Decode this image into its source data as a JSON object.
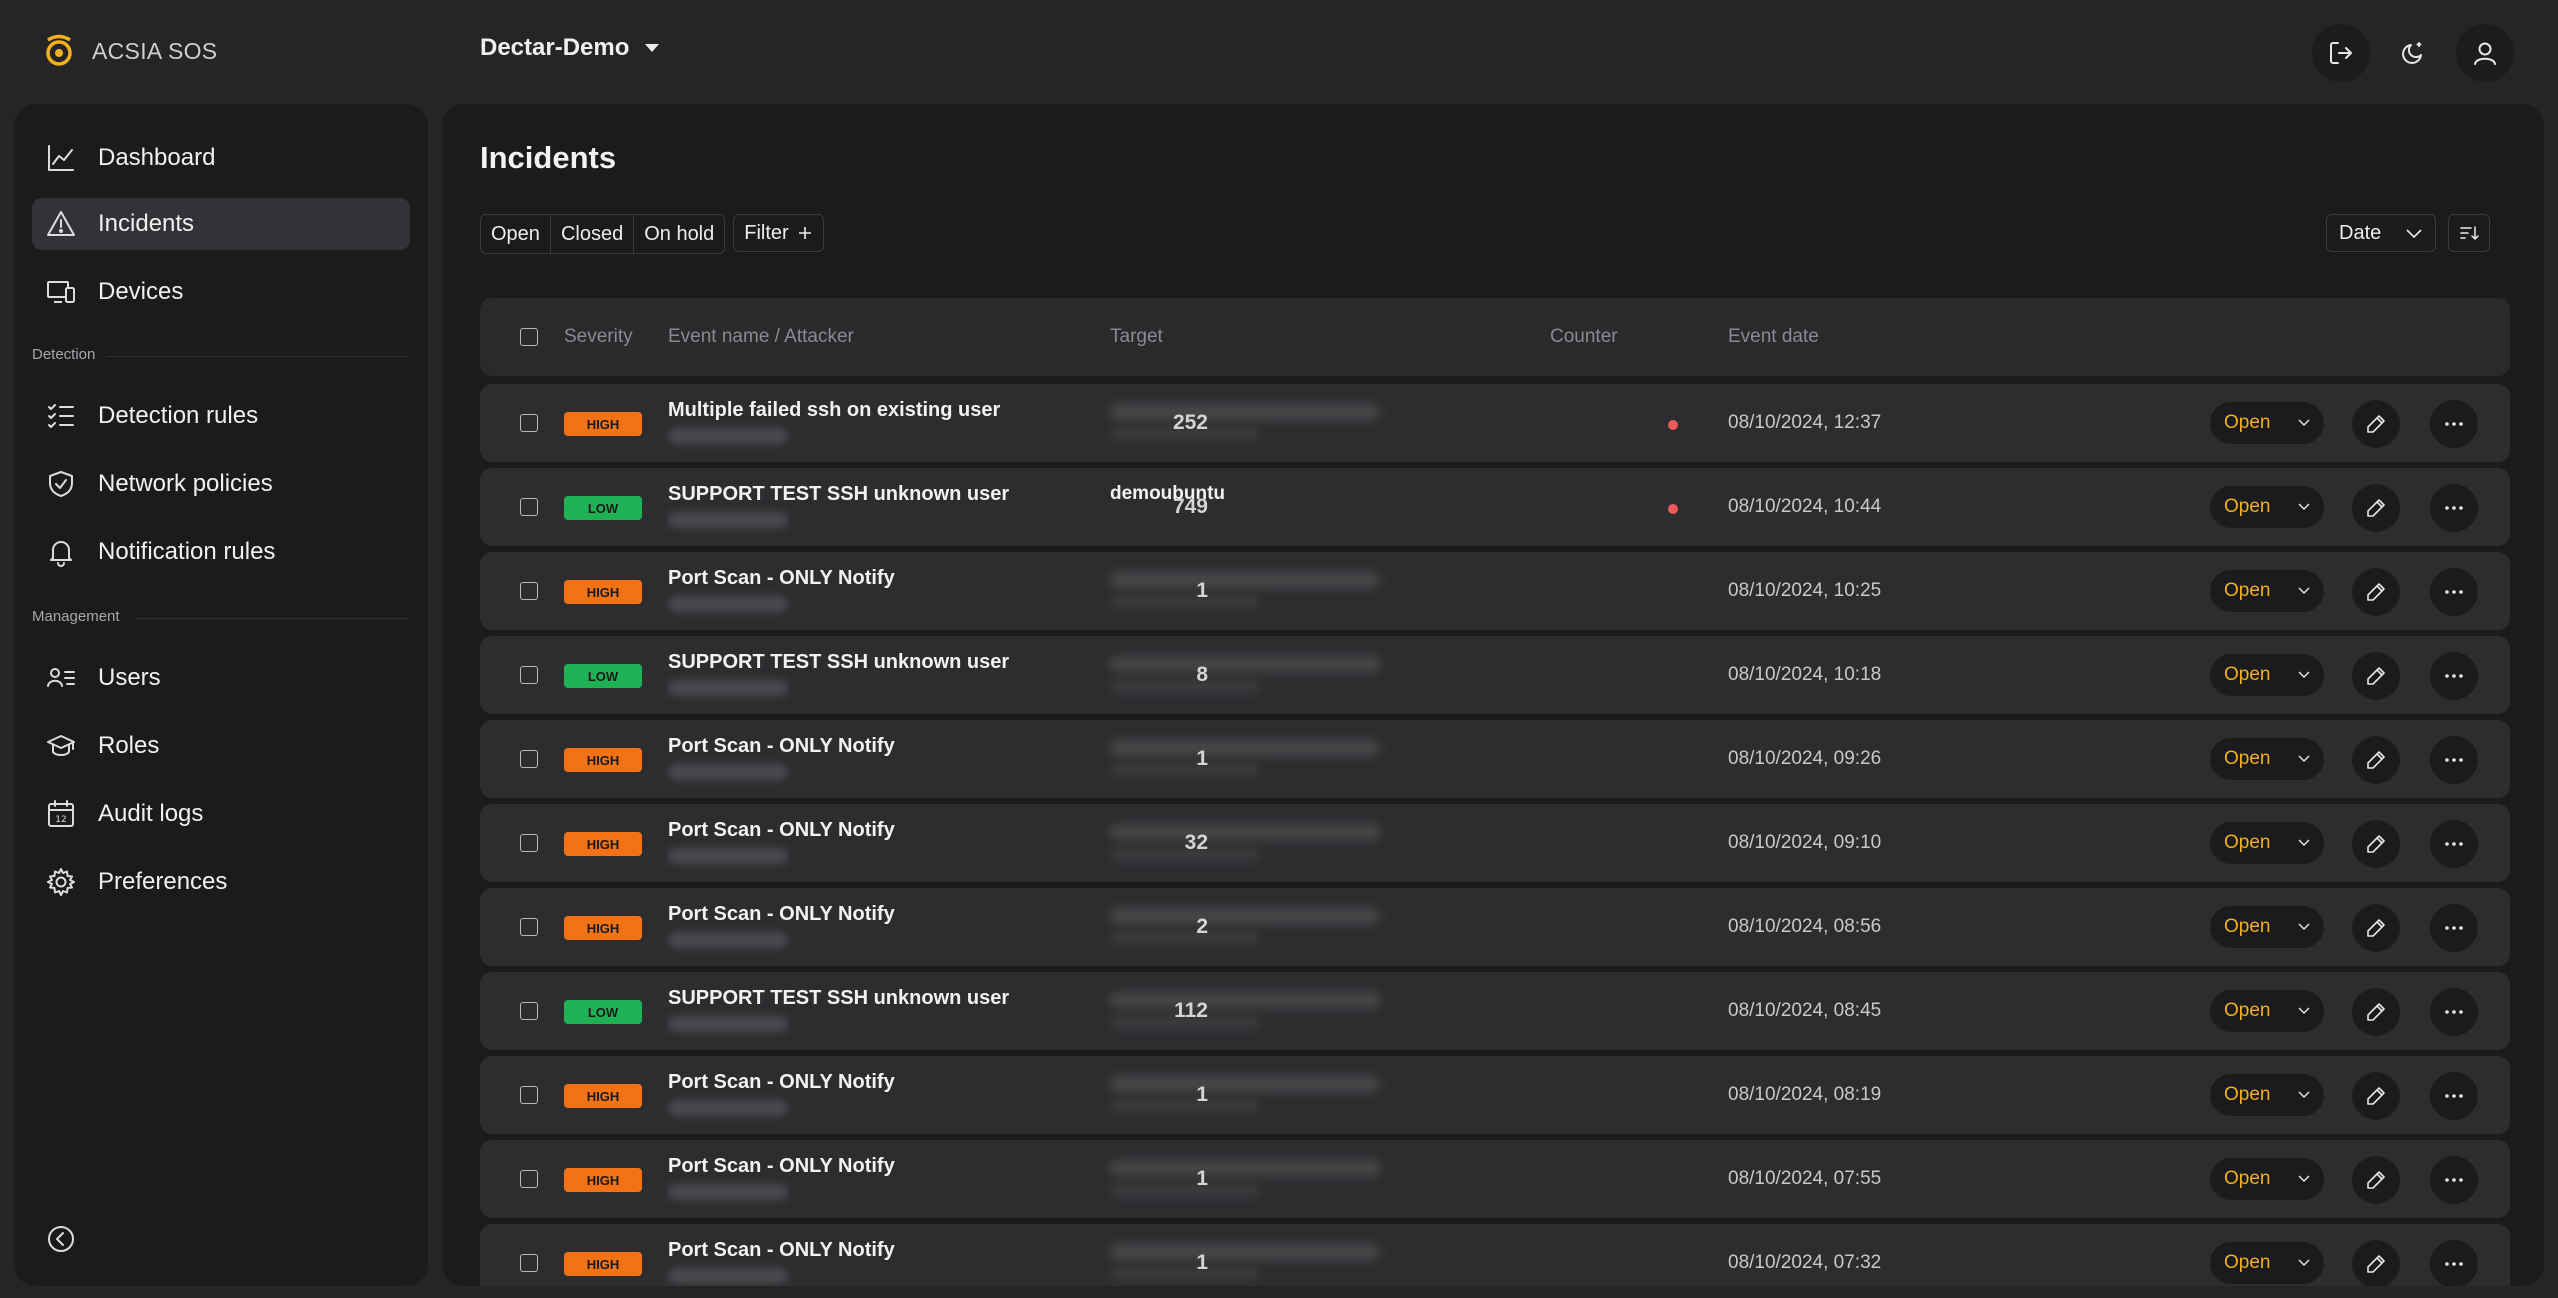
{
  "app": {
    "name": "ACSIA SOS",
    "org": "Dectar-Demo"
  },
  "sidebar": {
    "items": [
      {
        "label": "Dashboard",
        "icon": "chart-line-icon"
      },
      {
        "label": "Incidents",
        "icon": "warning-triangle-icon",
        "active": true
      },
      {
        "label": "Devices",
        "icon": "devices-icon"
      },
      {
        "label": "Detection rules",
        "icon": "checklist-icon"
      },
      {
        "label": "Network policies",
        "icon": "shield-check-icon"
      },
      {
        "label": "Notification rules",
        "icon": "bell-icon"
      },
      {
        "label": "Users",
        "icon": "users-list-icon"
      },
      {
        "label": "Roles",
        "icon": "graduation-cap-icon"
      },
      {
        "label": "Audit logs",
        "icon": "calendar-icon"
      },
      {
        "label": "Preferences",
        "icon": "gear-icon"
      }
    ],
    "sections": {
      "detection": "Detection",
      "management": "Management"
    }
  },
  "page": {
    "title": "Incidents"
  },
  "filters": {
    "open": "Open",
    "closed": "Closed",
    "on_hold": "On hold",
    "filter": "Filter"
  },
  "sort": {
    "field": "Date"
  },
  "table": {
    "headers": {
      "severity": "Severity",
      "event": "Event name / Attacker",
      "target": "Target",
      "counter": "Counter",
      "date": "Event date"
    },
    "rows": [
      {
        "severity": "HIGH",
        "event": "Multiple failed ssh on existing user",
        "target": "",
        "counter": "252",
        "alert": true,
        "date": "08/10/2024, 12:37",
        "status": "Open"
      },
      {
        "severity": "LOW",
        "event": "SUPPORT TEST SSH unknown user",
        "target": "demoubuntu",
        "counter": "749",
        "alert": true,
        "date": "08/10/2024, 10:44",
        "status": "Open"
      },
      {
        "severity": "HIGH",
        "event": "Port Scan - ONLY Notify",
        "target": "",
        "counter": "1",
        "alert": false,
        "date": "08/10/2024, 10:25",
        "status": "Open"
      },
      {
        "severity": "LOW",
        "event": "SUPPORT TEST SSH unknown user",
        "target": "",
        "counter": "8",
        "alert": false,
        "date": "08/10/2024, 10:18",
        "status": "Open"
      },
      {
        "severity": "HIGH",
        "event": "Port Scan - ONLY Notify",
        "target": "",
        "counter": "1",
        "alert": false,
        "date": "08/10/2024, 09:26",
        "status": "Open"
      },
      {
        "severity": "HIGH",
        "event": "Port Scan - ONLY Notify",
        "target": "",
        "counter": "32",
        "alert": false,
        "date": "08/10/2024, 09:10",
        "status": "Open"
      },
      {
        "severity": "HIGH",
        "event": "Port Scan - ONLY Notify",
        "target": "",
        "counter": "2",
        "alert": false,
        "date": "08/10/2024, 08:56",
        "status": "Open"
      },
      {
        "severity": "LOW",
        "event": "SUPPORT TEST SSH unknown user",
        "target": "",
        "counter": "112",
        "alert": false,
        "date": "08/10/2024, 08:45",
        "status": "Open"
      },
      {
        "severity": "HIGH",
        "event": "Port Scan - ONLY Notify",
        "target": "",
        "counter": "1",
        "alert": false,
        "date": "08/10/2024, 08:19",
        "status": "Open"
      },
      {
        "severity": "HIGH",
        "event": "Port Scan - ONLY Notify",
        "target": "",
        "counter": "1",
        "alert": false,
        "date": "08/10/2024, 07:55",
        "status": "Open"
      },
      {
        "severity": "HIGH",
        "event": "Port Scan - ONLY Notify",
        "target": "",
        "counter": "1",
        "alert": false,
        "date": "08/10/2024, 07:32",
        "status": "Open"
      }
    ]
  },
  "colors": {
    "accent": "#f2b01e",
    "high": "#f47216",
    "low": "#1fb255",
    "alert_dot": "#ec5a5a"
  }
}
